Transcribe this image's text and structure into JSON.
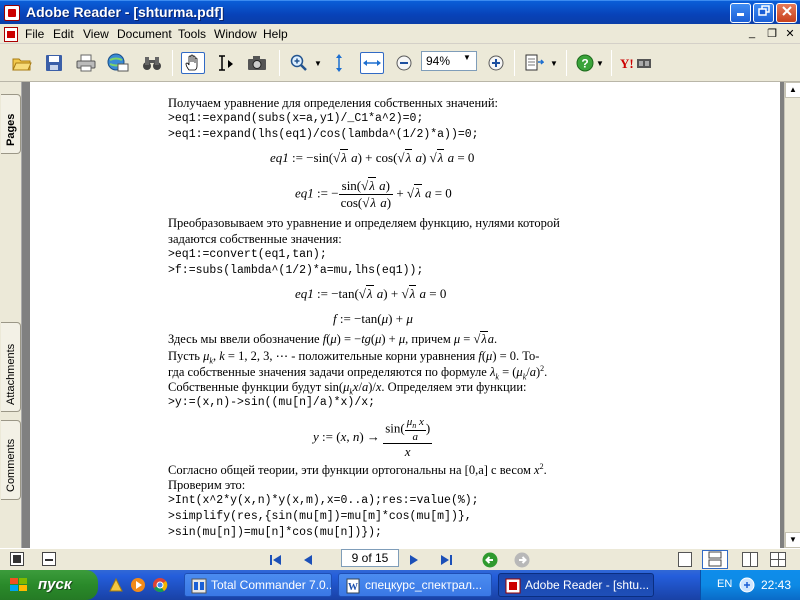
{
  "window": {
    "title": "Adobe Reader - [shturma.pdf]",
    "controls": [
      "minimize",
      "maximize",
      "close"
    ]
  },
  "menu": {
    "items": [
      "File",
      "Edit",
      "View",
      "Document",
      "Tools",
      "Window",
      "Help"
    ]
  },
  "toolbar": {
    "zoom_value": "94%"
  },
  "left_panel": {
    "tabs": [
      "Pages",
      "Attachments",
      "Comments"
    ]
  },
  "document": {
    "lines": {
      "p1": "Получаем уравнение для определения собственных значений:",
      "c1": ">eq1:=expand(subs(x=a,y1)/_C1*a^2)=0;",
      "c2": ">eq1:=expand(lhs(eq1)/cos(lambda^(1/2)*a))=0;",
      "p2a": "Преобразовываем это уравнение и определяем функцию, нулями которой",
      "p2b": "задаются собственные значения:",
      "c3": ">eq1:=convert(eq1,tan);",
      "c4": ">f:=subs(lambda^(1/2)*a=mu,lhs(eq1));",
      "c5": ">y:=(x,n)->sin((mu[n]/a)*x)/x;",
      "p5a": "Согласно общей теории, эти функции ортогональны на [0,a] с весом",
      "p5b": "Проверим это:",
      "c6": ">Int(x^2*y(x,n)*y(x,m),x=0..a);res:=value(%);",
      "c7": ">simplify(res,{sin(mu[m])=mu[m]*cos(mu[m])},",
      "c8": ">sin(mu[n])=mu[n]*cos(mu[n])});"
    },
    "p3": {
      "t1": "Здесь мы ввели обозначение ",
      "t2": ", причем "
    },
    "p4": {
      "t1": "Пусть ",
      "t2": " - положительные корни уравнения ",
      "t3": ". То-",
      "t4": "гда собственные значения задачи определяются по формуле ",
      "t5": "Собственные функции будут ",
      "t6": ". Определяем эти функции:"
    }
  },
  "status": {
    "page_field": "9 of 15"
  },
  "taskbar": {
    "start_label": "пуск",
    "tasks": [
      "Total Commander 7.0...",
      "спецкурс_спектрал...",
      "Adobe Reader - [shtu..."
    ],
    "language": "EN",
    "clock": "22:43"
  },
  "colors": {
    "titlebar": "#0a5ed8",
    "taskbar": "#245edb",
    "start": "#2a8a2a",
    "chrome": "#ece9d8"
  }
}
